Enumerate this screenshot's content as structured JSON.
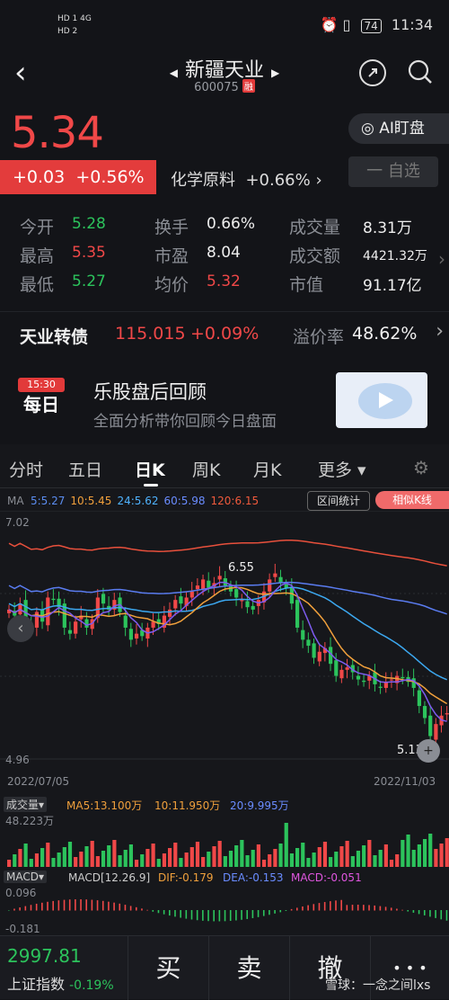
{
  "status_bar": {
    "left_line1": "HD 1 4G",
    "left_line2": "HD 2",
    "battery": "74",
    "time": "11:34"
  },
  "header": {
    "title": "新疆天业",
    "code": "600075",
    "tag": "融"
  },
  "quote": {
    "price": "5.34",
    "change": "+0.03",
    "change_pct": "+0.56%",
    "sector": "化学原料",
    "sector_pct": "+0.66%",
    "ai_button": "AI盯盘",
    "watch_button": "一 自选"
  },
  "stats": [
    [
      {
        "label": "今开",
        "value": "5.28",
        "color": "green"
      },
      {
        "label": "换手",
        "value": "0.66%",
        "color": "white"
      },
      {
        "label": "成交量",
        "value": "8.31万",
        "color": "white"
      }
    ],
    [
      {
        "label": "最高",
        "value": "5.35",
        "color": "red"
      },
      {
        "label": "市盈",
        "value": "8.04",
        "color": "white"
      },
      {
        "label": "成交额",
        "value": "4421.32万",
        "color": "white"
      }
    ],
    [
      {
        "label": "最低",
        "value": "5.27",
        "color": "green"
      },
      {
        "label": "均价",
        "value": "5.32",
        "color": "red"
      },
      {
        "label": "市值",
        "value": "91.17亿",
        "color": "white"
      }
    ]
  ],
  "bond": {
    "name": "天业转债",
    "price": "115.015",
    "pct": "+0.09%",
    "premium_label": "溢价率",
    "premium": "48.62%"
  },
  "banner": {
    "badge_time": "15:30",
    "badge_text": "每日",
    "title": "乐股盘后回顾",
    "subtitle": "全面分析带你回顾今日盘面"
  },
  "tabs": [
    "分时",
    "五日",
    "日K",
    "周K",
    "月K",
    "更多"
  ],
  "active_tab": "日K",
  "ma": {
    "label": "MA",
    "items": [
      {
        "text": "5:5.27",
        "color": "#5b8df0"
      },
      {
        "text": "10:5.45",
        "color": "#f0a03c"
      },
      {
        "text": "24:5.62",
        "color": "#4fb3ff"
      },
      {
        "text": "60:5.98",
        "color": "#6a8cff"
      },
      {
        "text": "120:6.15",
        "color": "#f05a3c"
      }
    ],
    "range_button": "区间统计",
    "similar_button": "相似K线"
  },
  "chart_data": {
    "type": "candlestick",
    "y_top_label": "7.02",
    "y_bottom_label": "4.96",
    "high_annotation": "6.55",
    "low_annotation": "5.13",
    "x_start": "2022/07/05",
    "x_end": "2022/11/03",
    "close": [
      6.2,
      6.15,
      6.25,
      6.1,
      6.05,
      6.18,
      6.1,
      6.3,
      6.28,
      6.22,
      6.05,
      6.0,
      6.1,
      6.15,
      6.05,
      6.12,
      6.3,
      6.25,
      6.2,
      6.28,
      6.18,
      6.05,
      5.95,
      6.0,
      5.98,
      6.05,
      6.1,
      6.08,
      6.15,
      6.2,
      6.28,
      6.25,
      6.3,
      6.35,
      6.4,
      6.45,
      6.38,
      6.42,
      6.48,
      6.4,
      6.35,
      6.3,
      6.28,
      6.22,
      6.2,
      6.28,
      6.35,
      6.45,
      6.5,
      6.42,
      6.38,
      6.25,
      6.05,
      5.95,
      5.9,
      5.8,
      5.85,
      5.88,
      5.75,
      5.65,
      5.7,
      5.72,
      5.68,
      5.62,
      5.6,
      5.65,
      5.58,
      5.55,
      5.6,
      5.62,
      5.65,
      5.63,
      5.6,
      5.55,
      5.4,
      5.3,
      5.15,
      5.25,
      5.32,
      5.34
    ]
  },
  "volume": {
    "label": "成交量",
    "ma5": "MA5:13.100万",
    "ma10": "10:11.950万",
    "ma20": "20:9.995万",
    "axis_top": "48.223万"
  },
  "macd": {
    "label": "MACD",
    "params": "MACD[12.26.9]",
    "dif": "DIF:-0.179",
    "dea": "DEA:-0.153",
    "macd": "MACD:-0.051",
    "axis_top": "0.096",
    "axis_bottom": "-0.181"
  },
  "bottom": {
    "index_value": "2997.81",
    "index_name": "上证指数",
    "index_pct": "-0.19%",
    "buy": "买",
    "sell": "卖",
    "cancel": "撤",
    "more": "• • •"
  },
  "watermark": "雪球：一念之间lxs"
}
